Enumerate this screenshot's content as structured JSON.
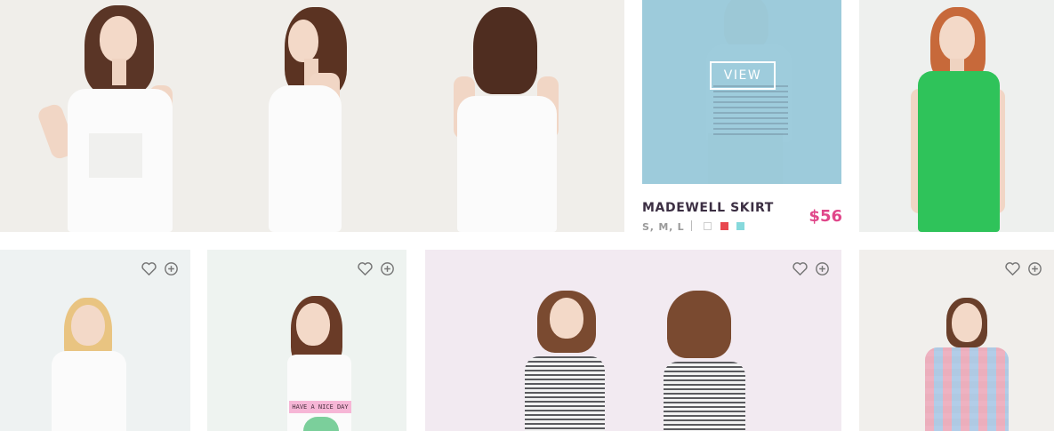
{
  "featured": {
    "view_label": "VIEW",
    "name": "MADEWELL SKIRT",
    "sizes": "S, M, L",
    "price": "$56",
    "swatches": [
      {
        "name": "white",
        "color": "#ffffff"
      },
      {
        "name": "red",
        "color": "#e8474f"
      },
      {
        "name": "aqua",
        "color": "#86d9dc"
      }
    ],
    "overlay_color": "#93c6d8"
  },
  "tees": {
    "print_text": "HAVE A NICE DAY"
  },
  "icons": {
    "wishlist": "heart-icon",
    "add": "plus-circle-icon"
  },
  "colors": {
    "price_accent": "#e0478a",
    "green_dress": "#2fc35a"
  }
}
